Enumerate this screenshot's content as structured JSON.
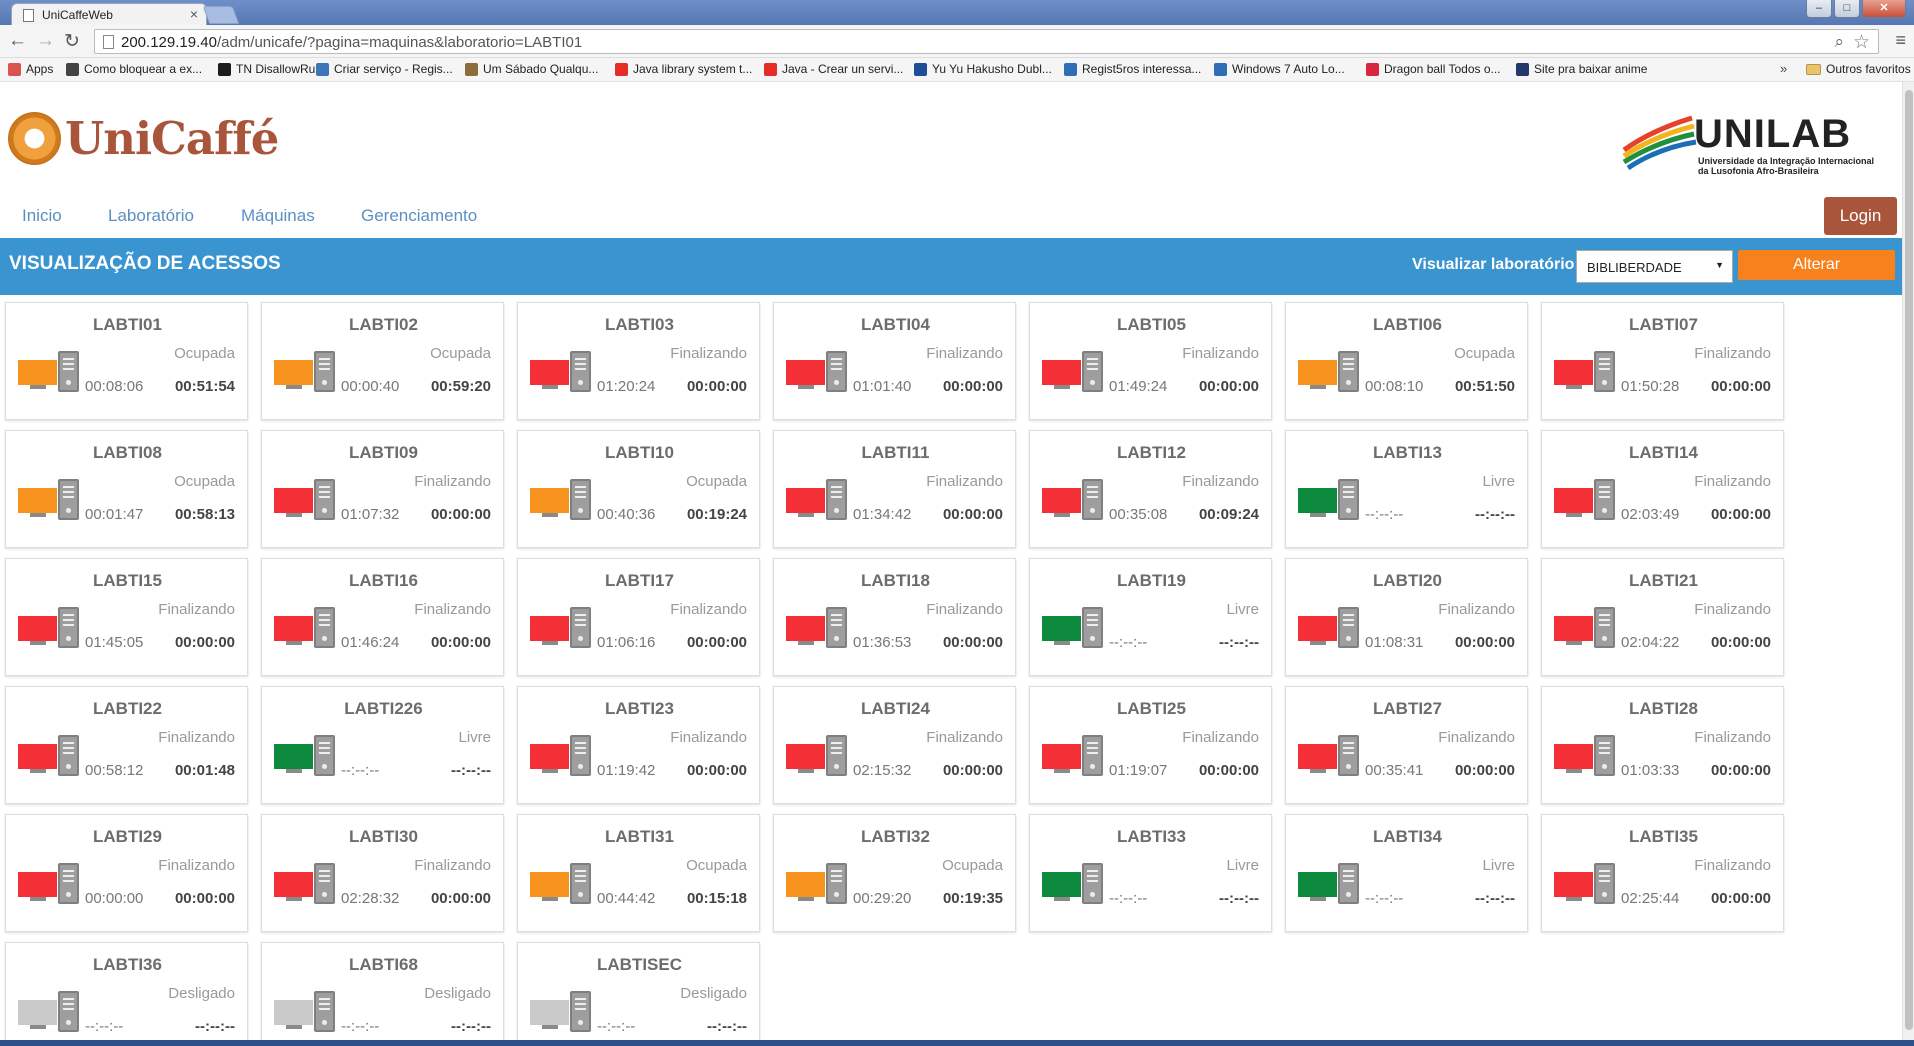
{
  "browser": {
    "tab_title": "UniCaffeWeb",
    "url_host": "200.129.19.40",
    "url_path": "/adm/unicafe/?pagina=maquinas&laboratorio=LABTI01",
    "bookmarks": [
      {
        "label": "Apps",
        "icon_color": "#d9534f"
      },
      {
        "label": "Como bloquear a ex...",
        "icon_color": "#444"
      },
      {
        "label": "TN DisallowRun",
        "icon_color": "#1b1b1b"
      },
      {
        "label": "Criar serviço - Regis...",
        "icon_color": "#3e74b8"
      },
      {
        "label": "Um Sábado Qualqu...",
        "icon_color": "#8a6d3b"
      },
      {
        "label": "Java library system t...",
        "icon_color": "#e52d27"
      },
      {
        "label": "Java - Crear un servi...",
        "icon_color": "#e52d27"
      },
      {
        "label": "Yu Yu Hakusho Dubl...",
        "icon_color": "#1f4e96"
      },
      {
        "label": "Regist5ros interessa...",
        "icon_color": "#2f6db5"
      },
      {
        "label": "Windows 7 Auto Lo...",
        "icon_color": "#2f6db5"
      },
      {
        "label": "Dragon ball Todos o...",
        "icon_color": "#d7263d"
      },
      {
        "label": "Site pra baixar anime",
        "icon_color": "#213a6b"
      }
    ],
    "more_label": "»",
    "other_bookmarks": "Outros favoritos"
  },
  "header": {
    "logo_text": "UniCaffé",
    "partner_logo": "UNILAB",
    "partner_subtitle_1": "Universidade da Integração Internacional",
    "partner_subtitle_2": "da Lusofonia Afro-Brasileira"
  },
  "nav": {
    "items": [
      "Inicio",
      "Laboratório",
      "Máquinas",
      "Gerenciamento"
    ],
    "login": "Login"
  },
  "banner": {
    "title": "VISUALIZAÇÃO DE ACESSOS",
    "lab_label": "Visualizar laboratório:",
    "lab_selected": "BIBLIBERDADE",
    "submit": "Alterar"
  },
  "colors": {
    "Ocupada": "#f7931e",
    "Finalizando": "#f52f36",
    "Livre": "#0e8a3e",
    "Desligado": "#c9c9c9",
    "banner": "#3a94d0",
    "brand": "#a8553b"
  },
  "machines": [
    {
      "name": "LABTI01",
      "status": "Ocupada",
      "elapsed": "00:08:06",
      "remaining": "00:51:54"
    },
    {
      "name": "LABTI02",
      "status": "Ocupada",
      "elapsed": "00:00:40",
      "remaining": "00:59:20"
    },
    {
      "name": "LABTI03",
      "status": "Finalizando",
      "elapsed": "01:20:24",
      "remaining": "00:00:00"
    },
    {
      "name": "LABTI04",
      "status": "Finalizando",
      "elapsed": "01:01:40",
      "remaining": "00:00:00"
    },
    {
      "name": "LABTI05",
      "status": "Finalizando",
      "elapsed": "01:49:24",
      "remaining": "00:00:00"
    },
    {
      "name": "LABTI06",
      "status": "Ocupada",
      "elapsed": "00:08:10",
      "remaining": "00:51:50"
    },
    {
      "name": "LABTI07",
      "status": "Finalizando",
      "elapsed": "01:50:28",
      "remaining": "00:00:00"
    },
    {
      "name": "LABTI08",
      "status": "Ocupada",
      "elapsed": "00:01:47",
      "remaining": "00:58:13"
    },
    {
      "name": "LABTI09",
      "status": "Finalizando",
      "elapsed": "01:07:32",
      "remaining": "00:00:00"
    },
    {
      "name": "LABTI10",
      "status": "Ocupada",
      "elapsed": "00:40:36",
      "remaining": "00:19:24"
    },
    {
      "name": "LABTI11",
      "status": "Finalizando",
      "elapsed": "01:34:42",
      "remaining": "00:00:00"
    },
    {
      "name": "LABTI12",
      "status": "Finalizando",
      "elapsed": "00:35:08",
      "remaining": "00:09:24"
    },
    {
      "name": "LABTI13",
      "status": "Livre",
      "elapsed": "--:--:--",
      "remaining": "--:--:--"
    },
    {
      "name": "LABTI14",
      "status": "Finalizando",
      "elapsed": "02:03:49",
      "remaining": "00:00:00"
    },
    {
      "name": "LABTI15",
      "status": "Finalizando",
      "elapsed": "01:45:05",
      "remaining": "00:00:00"
    },
    {
      "name": "LABTI16",
      "status": "Finalizando",
      "elapsed": "01:46:24",
      "remaining": "00:00:00"
    },
    {
      "name": "LABTI17",
      "status": "Finalizando",
      "elapsed": "01:06:16",
      "remaining": "00:00:00"
    },
    {
      "name": "LABTI18",
      "status": "Finalizando",
      "elapsed": "01:36:53",
      "remaining": "00:00:00"
    },
    {
      "name": "LABTI19",
      "status": "Livre",
      "elapsed": "--:--:--",
      "remaining": "--:--:--"
    },
    {
      "name": "LABTI20",
      "status": "Finalizando",
      "elapsed": "01:08:31",
      "remaining": "00:00:00"
    },
    {
      "name": "LABTI21",
      "status": "Finalizando",
      "elapsed": "02:04:22",
      "remaining": "00:00:00"
    },
    {
      "name": "LABTI22",
      "status": "Finalizando",
      "elapsed": "00:58:12",
      "remaining": "00:01:48"
    },
    {
      "name": "LABTI226",
      "status": "Livre",
      "elapsed": "--:--:--",
      "remaining": "--:--:--"
    },
    {
      "name": "LABTI23",
      "status": "Finalizando",
      "elapsed": "01:19:42",
      "remaining": "00:00:00"
    },
    {
      "name": "LABTI24",
      "status": "Finalizando",
      "elapsed": "02:15:32",
      "remaining": "00:00:00"
    },
    {
      "name": "LABTI25",
      "status": "Finalizando",
      "elapsed": "01:19:07",
      "remaining": "00:00:00"
    },
    {
      "name": "LABTI27",
      "status": "Finalizando",
      "elapsed": "00:35:41",
      "remaining": "00:00:00"
    },
    {
      "name": "LABTI28",
      "status": "Finalizando",
      "elapsed": "01:03:33",
      "remaining": "00:00:00"
    },
    {
      "name": "LABTI29",
      "status": "Finalizando",
      "elapsed": "00:00:00",
      "remaining": "00:00:00"
    },
    {
      "name": "LABTI30",
      "status": "Finalizando",
      "elapsed": "02:28:32",
      "remaining": "00:00:00"
    },
    {
      "name": "LABTI31",
      "status": "Ocupada",
      "elapsed": "00:44:42",
      "remaining": "00:15:18"
    },
    {
      "name": "LABTI32",
      "status": "Ocupada",
      "elapsed": "00:29:20",
      "remaining": "00:19:35"
    },
    {
      "name": "LABTI33",
      "status": "Livre",
      "elapsed": "--:--:--",
      "remaining": "--:--:--"
    },
    {
      "name": "LABTI34",
      "status": "Livre",
      "elapsed": "--:--:--",
      "remaining": "--:--:--"
    },
    {
      "name": "LABTI35",
      "status": "Finalizando",
      "elapsed": "02:25:44",
      "remaining": "00:00:00"
    },
    {
      "name": "LABTI36",
      "status": "Desligado",
      "elapsed": "--:--:--",
      "remaining": "--:--:--"
    },
    {
      "name": "LABTI68",
      "status": "Desligado",
      "elapsed": "--:--:--",
      "remaining": "--:--:--"
    },
    {
      "name": "LABTISEC",
      "status": "Desligado",
      "elapsed": "--:--:--",
      "remaining": "--:--:--"
    }
  ]
}
